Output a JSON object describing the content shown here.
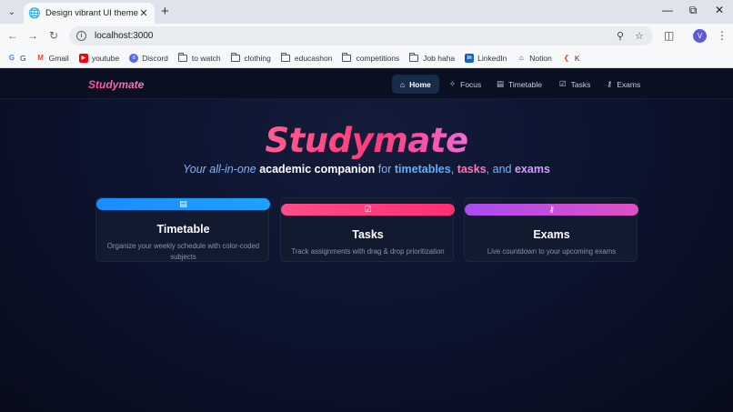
{
  "browser": {
    "tab_title": "Design vibrant UI theme",
    "url": "localhost:3000",
    "profile_initial": "V",
    "bookmarks": [
      {
        "label": "G",
        "icon": "google-icon"
      },
      {
        "label": "Gmail",
        "icon": "gmail-icon"
      },
      {
        "label": "youtube",
        "icon": "youtube-icon"
      },
      {
        "label": "Discord",
        "icon": "discord-icon"
      },
      {
        "label": "to watch",
        "icon": "folder-icon"
      },
      {
        "label": "clothing",
        "icon": "folder-icon"
      },
      {
        "label": "educashon",
        "icon": "folder-icon"
      },
      {
        "label": "competitions",
        "icon": "folder-icon"
      },
      {
        "label": "Job haha",
        "icon": "folder-icon"
      },
      {
        "label": "LinkedIn",
        "icon": "linkedin-icon"
      },
      {
        "label": "Notion",
        "icon": "notion-icon"
      },
      {
        "label": "K",
        "icon": "k-icon"
      }
    ]
  },
  "app": {
    "brand": "Studymate",
    "nav": [
      {
        "label": "Home",
        "icon": "home-icon",
        "active": true
      },
      {
        "label": "Focus",
        "icon": "sparkle-icon",
        "active": false
      },
      {
        "label": "Timetable",
        "icon": "calendar-icon",
        "active": false
      },
      {
        "label": "Tasks",
        "icon": "checkbox-icon",
        "active": false
      },
      {
        "label": "Exams",
        "icon": "trophy-icon",
        "active": false
      }
    ],
    "hero": {
      "title": "Studymate",
      "tagline": {
        "part1": "Your all-in-one",
        "part2": "academic companion",
        "part3": "for",
        "part4": "timetables",
        "part5": ",",
        "part6": "tasks",
        "part7": ", and",
        "part8": "exams"
      }
    },
    "cards": [
      {
        "title": "Timetable",
        "description": "Organize your weekly schedule with color-coded subjects",
        "icon": "calendar-icon",
        "color": "#1a8cff"
      },
      {
        "title": "Tasks",
        "description": "Track assignments with drag & drop prioritization",
        "icon": "checkbox-icon",
        "color": "#ff3d7f"
      },
      {
        "title": "Exams",
        "description": "Live countdown to your upcoming exams",
        "icon": "trophy-icon",
        "color": "#b552e8"
      }
    ]
  }
}
